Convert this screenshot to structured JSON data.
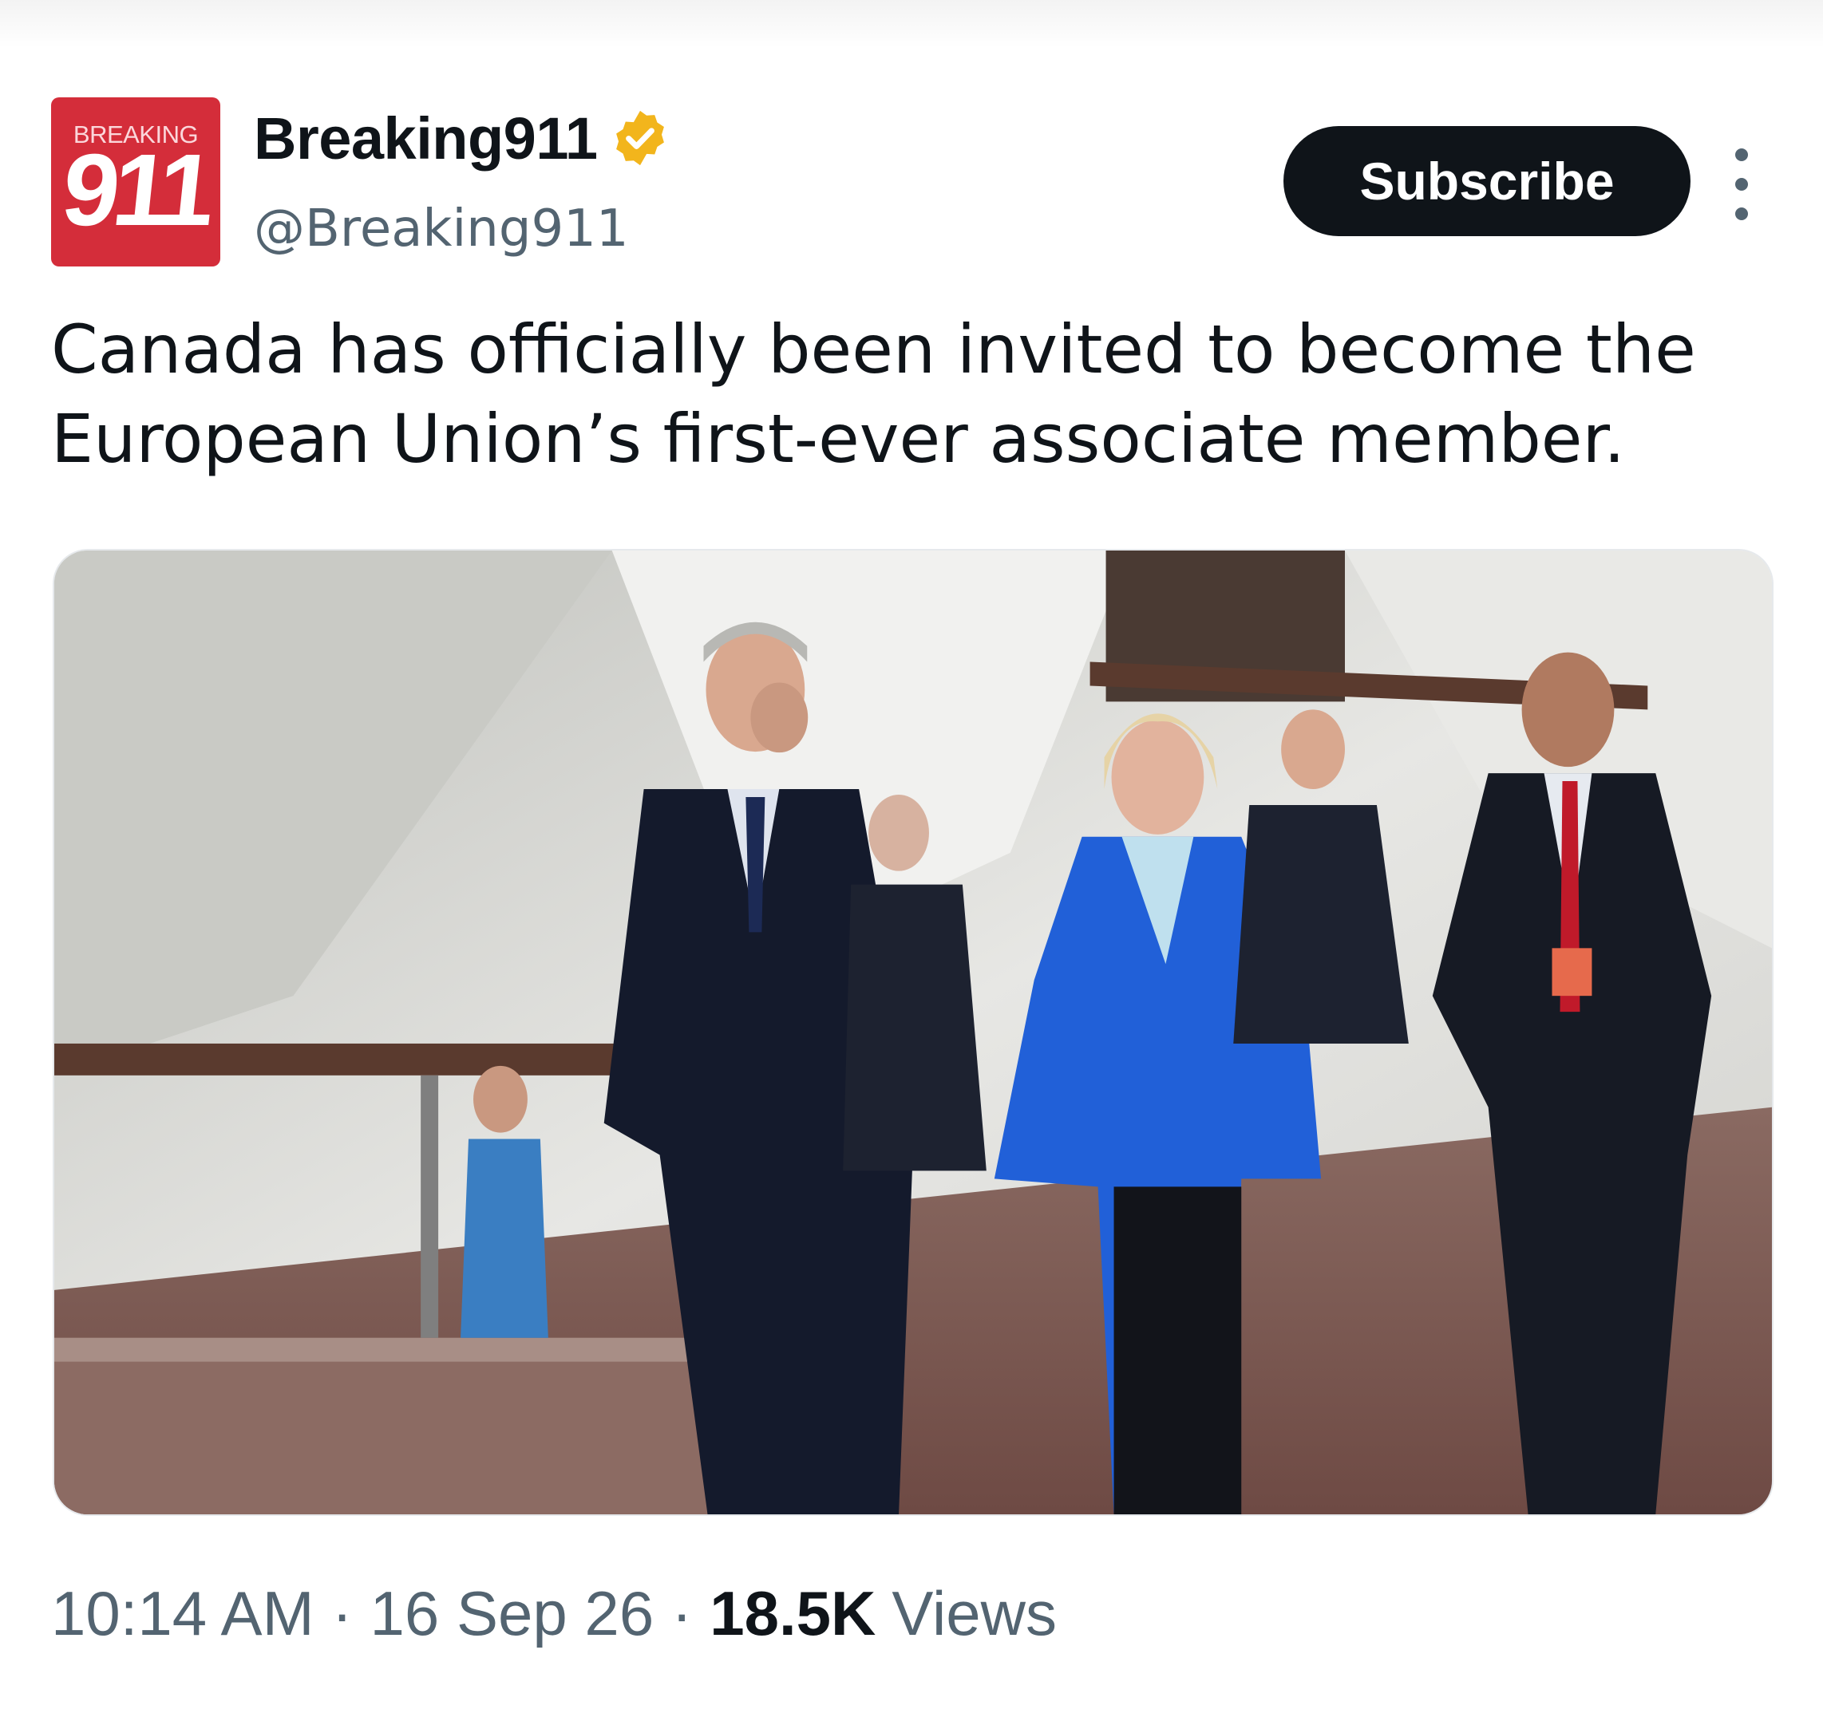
{
  "author": {
    "logo_small_text": "BREAKING",
    "logo_big_text": "911",
    "name": "Breaking911",
    "handle": "@Breaking911",
    "verified_icon": "verified-badge-icon",
    "verified_color": "#f2b51c"
  },
  "actions": {
    "subscribe_label": "Subscribe",
    "more_icon": "more-vertical-icon"
  },
  "post": {
    "text": "Canada has officially been invited to become the\nEuropean Union’s first-ever associate member."
  },
  "meta": {
    "time": "10:14 AM",
    "separator": "·",
    "date": "16 Sep 26",
    "views_count": "18.5K",
    "views_label": "Views"
  },
  "colors": {
    "logo_red": "#d42d3a",
    "text_primary": "#0f1419",
    "text_secondary": "#536471",
    "button_bg": "#0f1419"
  }
}
